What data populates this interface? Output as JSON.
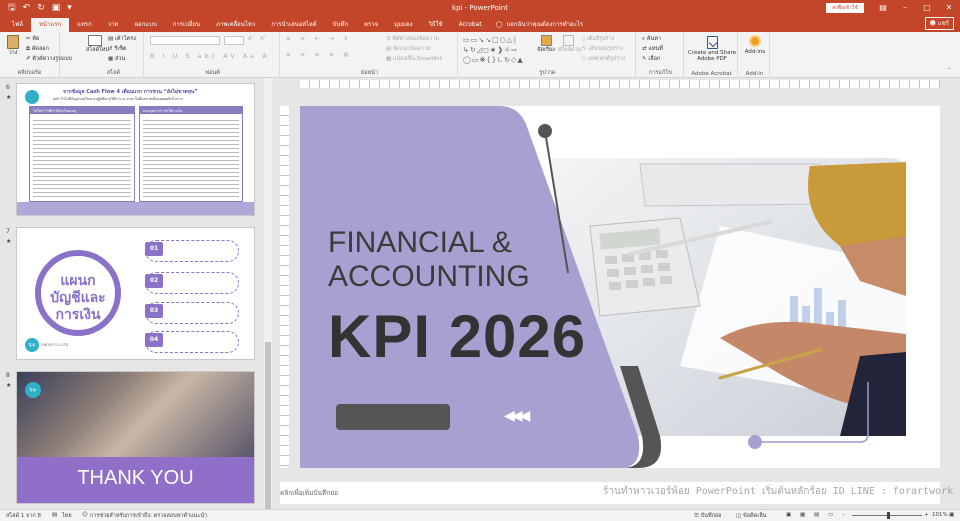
{
  "window": {
    "title": "kpi  -  PowerPoint",
    "signin_label": "ลงชื่อเข้าใช้",
    "share_label": "แชร์",
    "qat_icons": [
      "save-icon",
      "undo-icon",
      "redo-icon",
      "present-icon",
      "customize-icon"
    ]
  },
  "tabs": [
    "ไฟล์",
    "หน้าแรก",
    "แทรก",
    "วาด",
    "ออกแบบ",
    "การเปลี่ยน",
    "ภาพเคลื่อนไหว",
    "การนำเสนอสไลด์",
    "บันทึก",
    "ตรวจ",
    "มุมมอง",
    "วิธีใช้",
    "Acrobat"
  ],
  "active_tab_index": 1,
  "tell_me": "บอกฉันว่าคุณต้องการทำอะไร",
  "ribbon": {
    "clipboard": {
      "label": "คลิปบอร์ด",
      "paste": "วาง",
      "cut": "ตัด",
      "copy": "คัดลอก",
      "format_painter": "ตัวคัดวางรูปแบบ"
    },
    "slides": {
      "label": "สไลด์",
      "new_slide": "สไลด์ใหม่",
      "layout": "เค้าโครง",
      "reset": "รีเซ็ต",
      "section": "ส่วน"
    },
    "font": {
      "label": "ฟอนต์"
    },
    "paragraph": {
      "label": "ย่อหน้า",
      "text_direction": "ทิศทางของข้อความ",
      "align_text": "จัดแนวข้อความ",
      "smartart": "แปลงเป็น SmartArt"
    },
    "drawing": {
      "label": "รูปวาด",
      "arrange": "จัดเรียง",
      "quick_styles": "สไตล์ด่วน",
      "shape_fill": "เติมสีรูปร่าง",
      "shape_outline": "เส้นขอบรูปร่าง",
      "shape_effects": "เอฟเฟกต์รูปร่าง"
    },
    "editing": {
      "label": "การแก้ไข",
      "find": "ค้นหา",
      "replace": "แทนที่",
      "select": "เลือก"
    },
    "acrobat": {
      "label": "Adobe Acrobat",
      "create_share_1": "Create and Share",
      "create_share_2": "Adobe PDF"
    },
    "addins": {
      "label": "Add-in",
      "button": "Add-ins"
    }
  },
  "thumbnails": [
    {
      "number": "6",
      "title": "จากข้อมูล Cash Flow 4 เดือนแรก การชวน “ยังไม่ขาดทุน”",
      "subtitle": "ผลกำไรไม่มีปัญหาแต่ในทางปฏิบัติตามวิธีการ ณ สาขาในอีกตลาดเพื่อลดผลผลิตในการ",
      "left_header": "ไม่ใช่กำไรที่ทำให้ธุรกิจคงอยู่",
      "right_header": "ควบคุมการกำลังใช้งานรับ"
    },
    {
      "number": "7",
      "circle_line1": "แผนก",
      "circle_line2": "บัญชีและ",
      "circle_line3": "การเงิน",
      "logo_text": "tpp",
      "logo_sub": "GROUP CO.,LTD",
      "items": [
        "01",
        "02",
        "03",
        "04"
      ]
    },
    {
      "number": "8",
      "logo_text": "tpp",
      "banner_text": "THANK YOU"
    }
  ],
  "slide": {
    "title_line1": "FINANCIAL &",
    "title_line2": "ACCOUNTING",
    "title_line3": "KPI 2026",
    "arrows": "◀◀◀",
    "colors": {
      "purple": "#a6a1d1",
      "dark": "#555555",
      "photo_bg": "#eeeeee"
    }
  },
  "notes_placeholder": "คลิกเพื่อเพิ่มบันทึกย่อ",
  "watermark": "ร้านทำพาวเวอร์พ้อย PowerPoint เริ่มต้นหลักร้อย ID LINE : forartwork",
  "status": {
    "slide_info": "สไลด์ 1 จาก 8",
    "language": "ไทย",
    "accessibility": "การช่วยสำหรับการเข้าถึง: ตรวจสอบหาคำแนะนำ",
    "notes_btn": "บันทึกย่อ",
    "comments_btn": "ข้อคิดเห็น",
    "zoom": "101%"
  }
}
